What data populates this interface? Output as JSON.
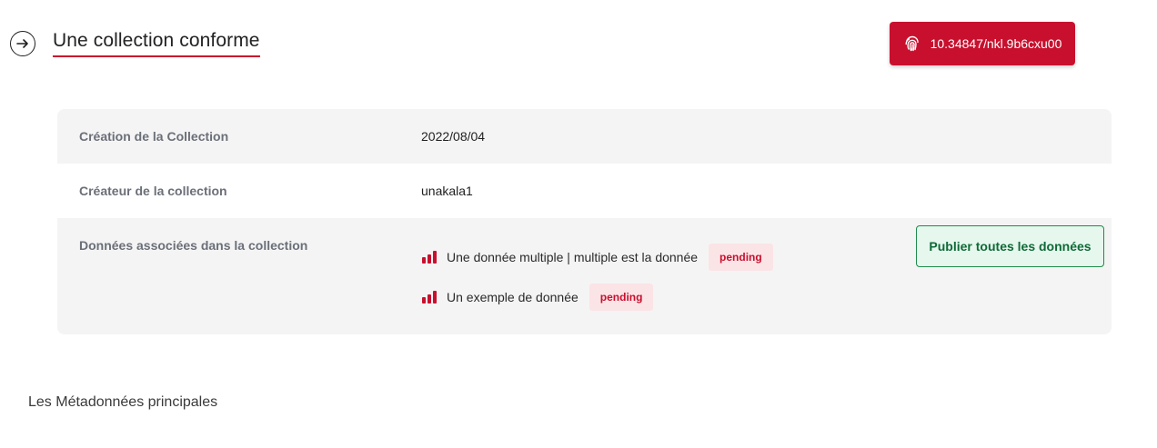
{
  "header": {
    "title": "Une collection conforme",
    "doi_label": "10.34847/nkl.9b6cxu00"
  },
  "info": {
    "creation_label": "Création de la Collection",
    "creation_value": "2022/08/04",
    "creator_label": "Créateur de la collection",
    "creator_value": "unakala1",
    "data_label": "Données associées dans la collection",
    "publish_button": "Publier toutes les données",
    "items": [
      {
        "title": "Une donnée multiple | multiple est la donnée",
        "status": "pending"
      },
      {
        "title": "Un exemple de donnée",
        "status": "pending"
      }
    ]
  },
  "sections": {
    "main_metadata": "Les Métadonnées principales"
  },
  "icons": {
    "back": "arrow-right-circle-icon",
    "doi": "fingerprint-icon",
    "data": "bar-chart-icon"
  },
  "colors": {
    "accent": "#c8102e",
    "success": "#1f8a4c",
    "success_bg": "#e6f7ee",
    "badge_bg": "#fbe4e6"
  }
}
